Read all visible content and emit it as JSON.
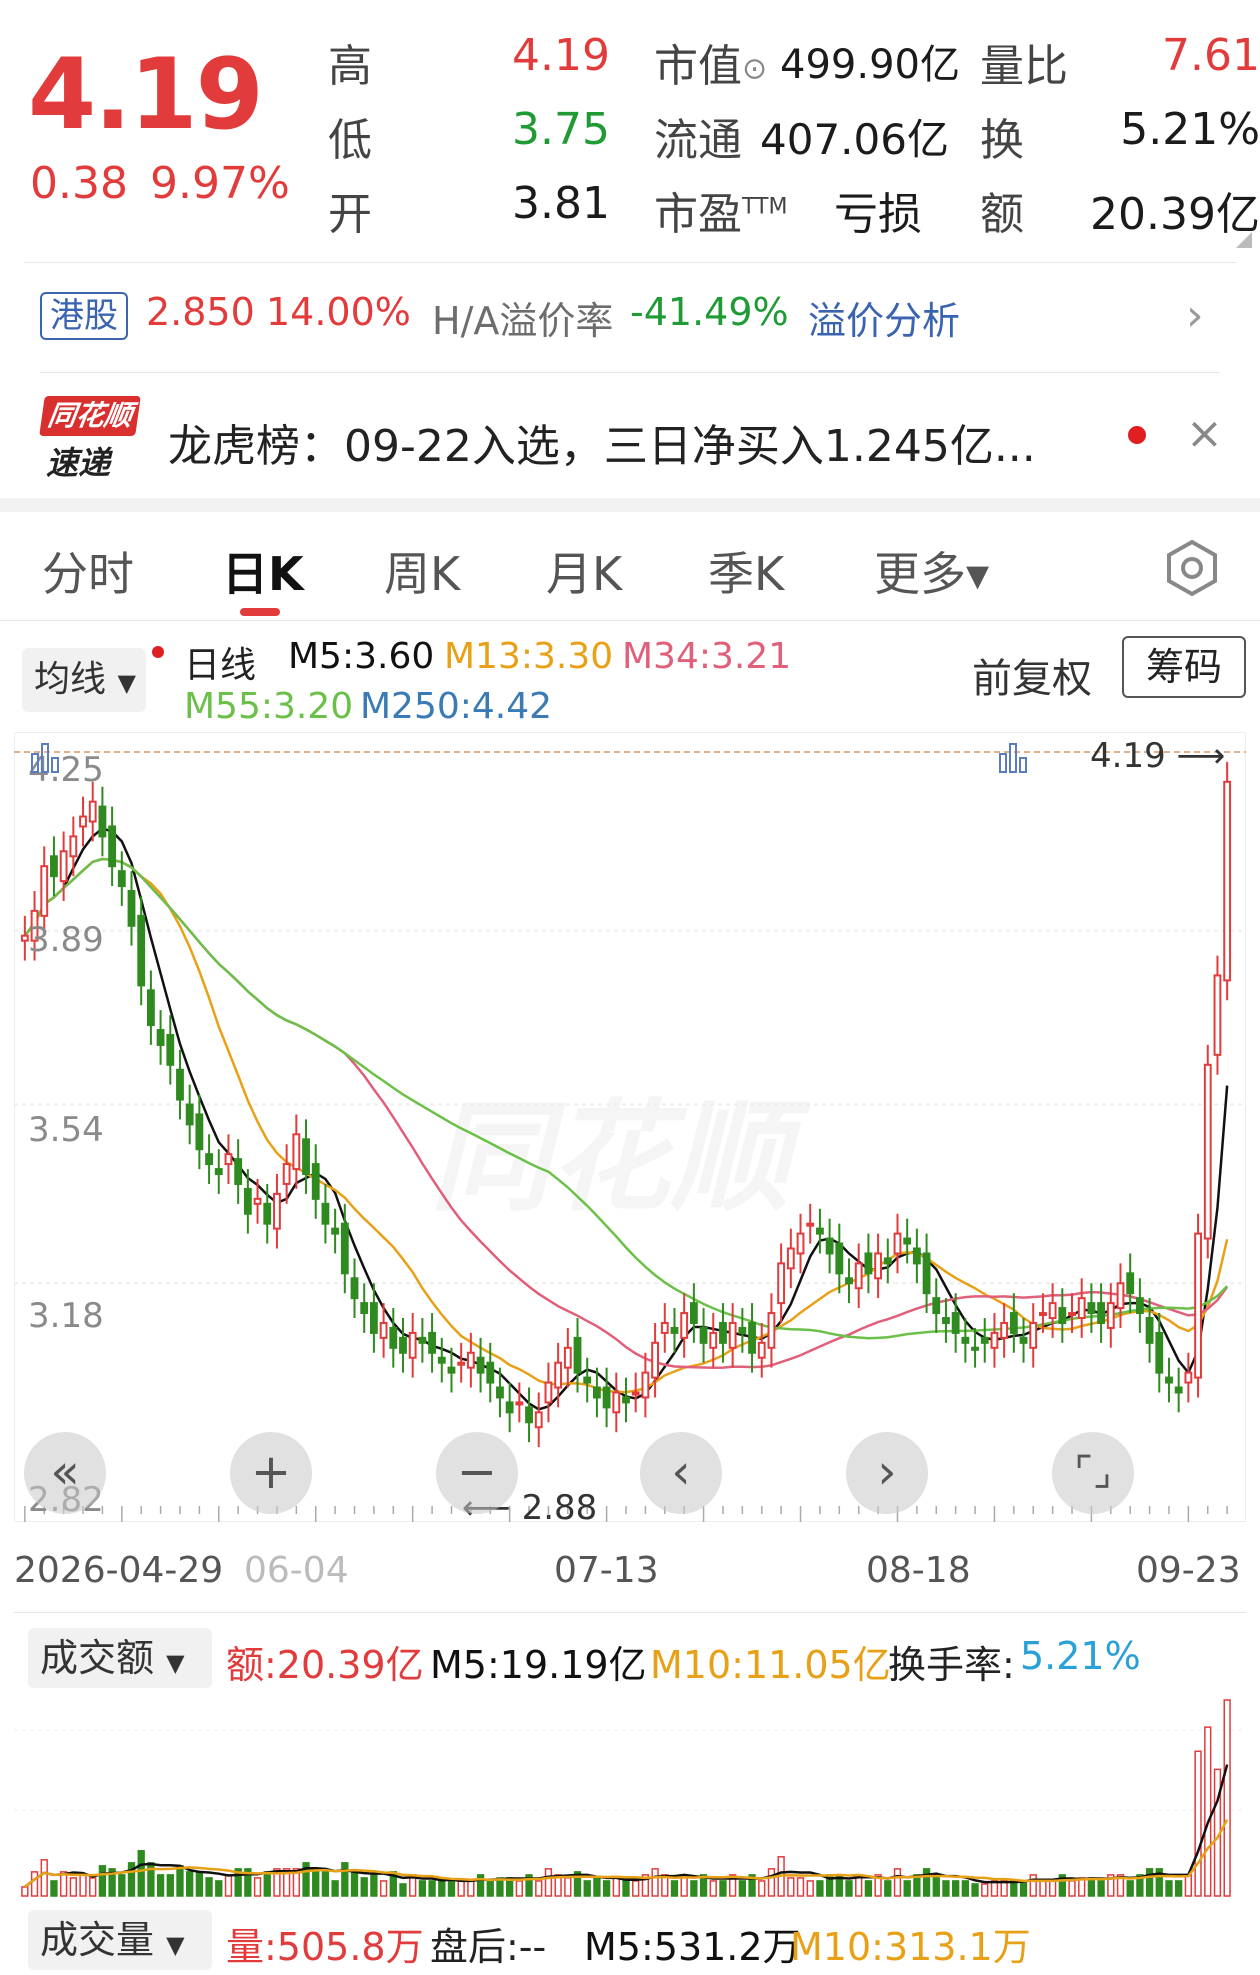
{
  "quote": {
    "price": "4.19",
    "change": "0.38",
    "change_pct": "9.97%",
    "high_label": "高",
    "high": "4.19",
    "low_label": "低",
    "low": "3.75",
    "open_label": "开",
    "open": "3.81",
    "mktcap_label": "市值",
    "mktcap": "499.90亿",
    "float_label": "流通",
    "float": "407.06亿",
    "pe_label": "市盈",
    "pe_sup": "TTM",
    "pe": "亏损",
    "volratio_label": "量比",
    "volratio": "7.61",
    "turnover_label": "换",
    "turnover": "5.21%",
    "amount_label": "额",
    "amount": "20.39亿"
  },
  "hk": {
    "badge": "港股",
    "price": "2.850",
    "pct": "14.00%",
    "premium_label": "H/A溢价率",
    "premium": "-41.49%",
    "analysis_link": "溢价分析"
  },
  "news": {
    "logo_top": "同花顺",
    "logo_bottom": "速递",
    "text": "龙虎榜：09-22入选，三日净买入1.245亿..."
  },
  "tabs": [
    {
      "label": "分时"
    },
    {
      "label": "日K"
    },
    {
      "label": "周K"
    },
    {
      "label": "月K"
    },
    {
      "label": "季K"
    },
    {
      "label": "更多▾"
    }
  ],
  "ma_legend": {
    "select": "均线",
    "period": "日线",
    "m5": "M5:3.60",
    "m13": "M13:3.30",
    "m34": "M34:3.21",
    "m55": "M55:3.20",
    "m250": "M250:4.42",
    "adjust": "前复权",
    "chips": "筹码"
  },
  "colors": {
    "up": "#e23b3b",
    "down": "#2f8a1f",
    "m5": "#111111",
    "m13": "#e8a117",
    "m34": "#e0607a",
    "m55": "#6cc04a",
    "m250": "#3a7ab5"
  },
  "chart_data": {
    "type": "candlestick",
    "y_ticks": [
      "4.25",
      "3.89",
      "3.54",
      "3.18",
      "2.82"
    ],
    "ylim": [
      2.82,
      4.25
    ],
    "x_ticks": [
      "2026-04-29",
      "06-04",
      "07-13",
      "08-18",
      "09-23"
    ],
    "high_mark": "4.19",
    "low_mark": "2.88",
    "close": [
      3.88,
      3.93,
      4.02,
      4.0,
      4.05,
      4.08,
      4.12,
      4.15,
      4.08,
      4.02,
      3.98,
      3.9,
      3.78,
      3.7,
      3.66,
      3.62,
      3.55,
      3.5,
      3.45,
      3.42,
      3.4,
      3.44,
      3.38,
      3.32,
      3.35,
      3.3,
      3.36,
      3.42,
      3.48,
      3.4,
      3.35,
      3.3,
      3.28,
      3.2,
      3.15,
      3.12,
      3.08,
      3.1,
      3.05,
      3.04,
      3.08,
      3.06,
      3.04,
      3.02,
      3.0,
      3.02,
      3.04,
      3.0,
      2.98,
      2.95,
      2.92,
      2.94,
      2.9,
      2.92,
      2.98,
      3.02,
      3.05,
      3.0,
      2.98,
      2.95,
      2.93,
      2.96,
      2.94,
      2.96,
      3.0,
      3.06,
      3.1,
      3.08,
      3.12,
      3.1,
      3.06,
      3.08,
      3.06,
      3.1,
      3.08,
      3.04,
      3.06,
      3.12,
      3.22,
      3.25,
      3.28,
      3.3,
      3.28,
      3.24,
      3.2,
      3.18,
      3.22,
      3.2,
      3.24,
      3.22,
      3.28,
      3.26,
      3.22,
      3.16,
      3.12,
      3.1,
      3.08,
      3.06,
      3.05,
      3.06,
      3.08,
      3.1,
      3.08,
      3.06,
      3.1,
      3.12,
      3.14,
      3.1,
      3.12,
      3.15,
      3.12,
      3.1,
      3.14,
      3.18,
      3.16,
      3.12,
      3.06,
      3.0,
      2.98,
      2.96,
      3.0,
      3.28,
      3.62,
      3.8,
      4.19
    ],
    "volume_label": "成交额",
    "volume_amount": "额:20.39亿",
    "volume_m5": "M5:19.19亿",
    "volume_m10": "M10:11.05亿",
    "turnover_label": "换手率:",
    "turnover_value": "5.21%"
  },
  "volume2": {
    "select": "成交量",
    "vol": "量:505.8万",
    "after": "盘后:--",
    "m5": "M5:531.2万",
    "m10": "M10:313.1万"
  }
}
